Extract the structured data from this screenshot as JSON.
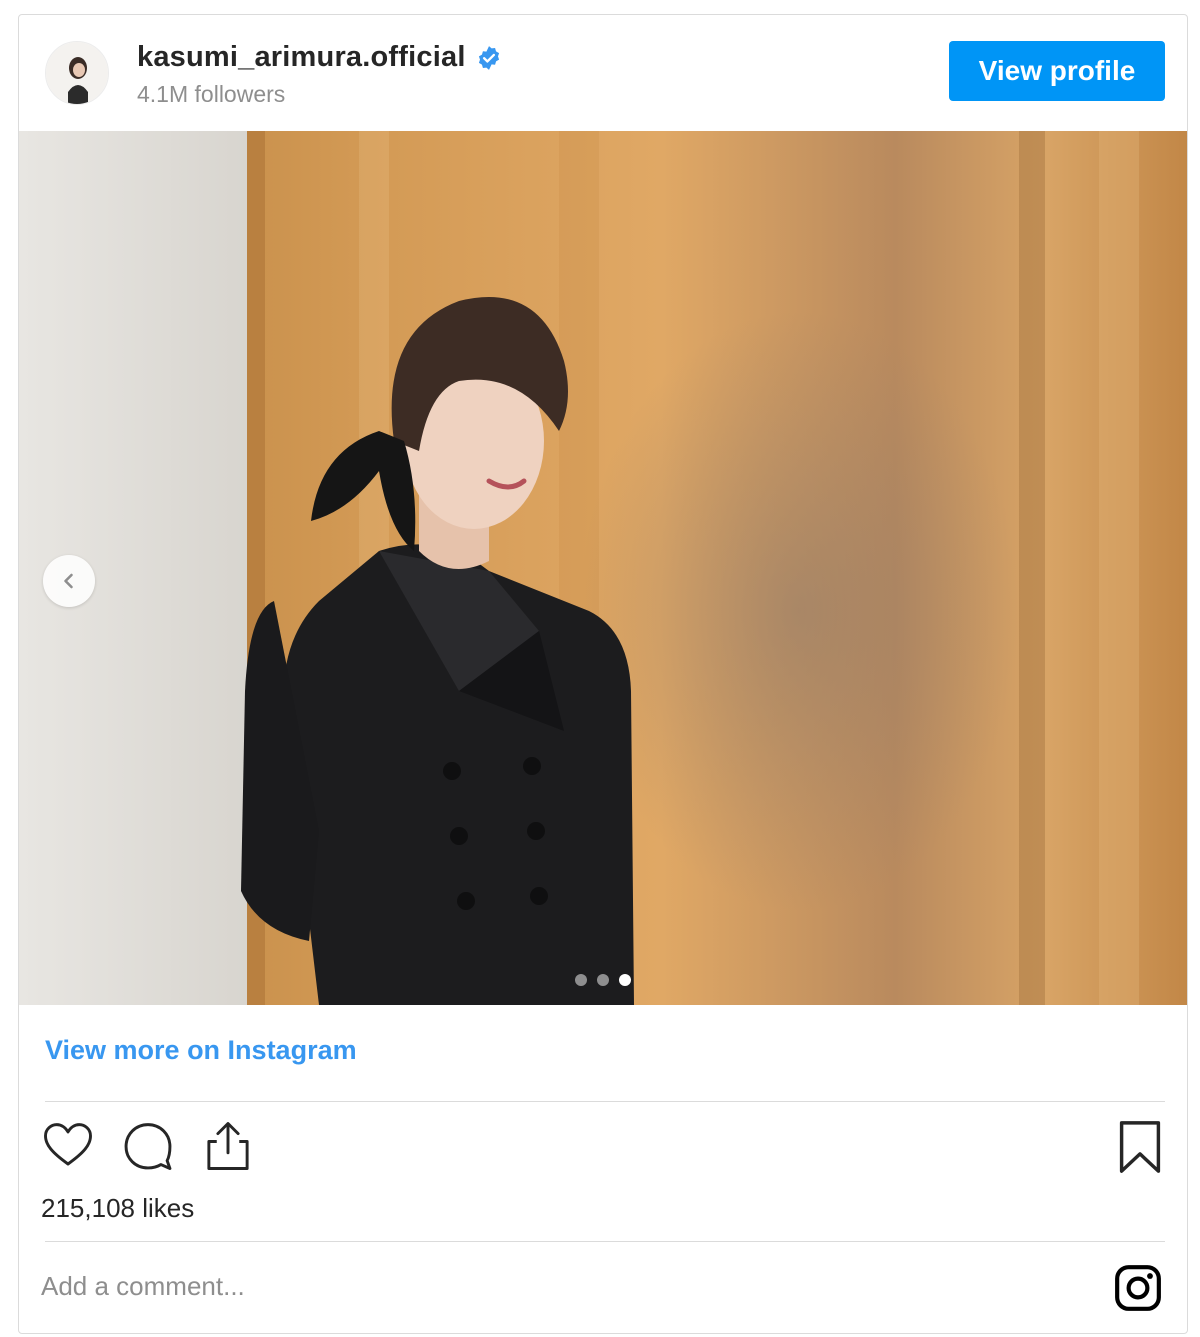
{
  "header": {
    "username": "kasumi_arimura.official",
    "followers": "4.1M followers",
    "view_profile_label": "View profile",
    "verified_icon": "verified-badge-icon"
  },
  "post": {
    "image_alt": "Woman in black double-breasted coat smiling in front of golden curtain",
    "carousel": {
      "total": 3,
      "current": 3
    }
  },
  "footer": {
    "view_more_label": "View more on Instagram",
    "likes": "215,108 likes",
    "comment_placeholder": "Add a comment..."
  },
  "icons": [
    "heart-icon",
    "comment-icon",
    "share-icon",
    "bookmark-icon",
    "instagram-icon",
    "chevron-left-icon"
  ],
  "colors": {
    "accent": "#0095f6",
    "link": "#3897f0",
    "muted": "#8e8e8e",
    "text": "#262626"
  }
}
